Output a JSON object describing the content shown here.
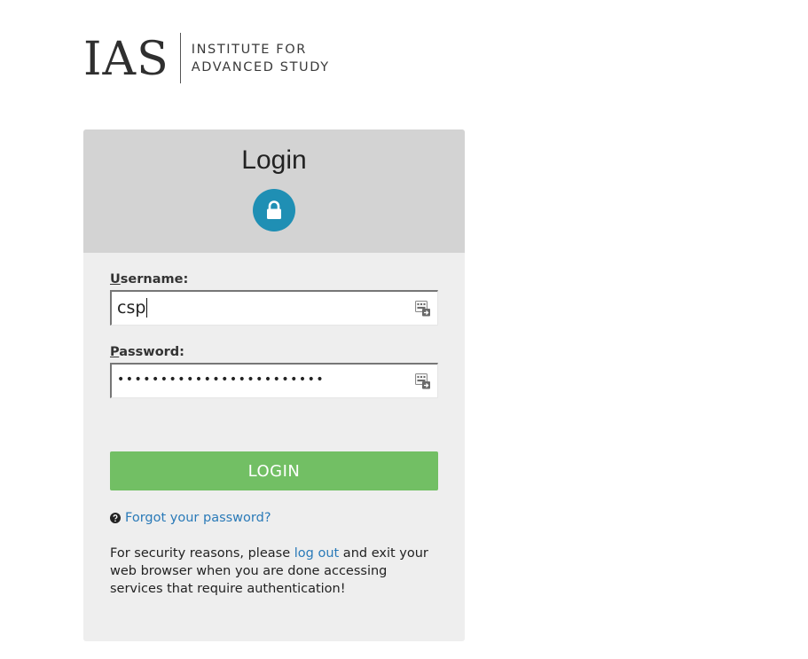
{
  "logo": {
    "mark": "IAS",
    "line1": "INSTITUTE FOR",
    "line2": "ADVANCED STUDY"
  },
  "login": {
    "title": "Login",
    "username_accesskey": "U",
    "username_label_rest": "sername:",
    "username_value": "csp",
    "password_accesskey": "P",
    "password_label_rest": "assword:",
    "password_mask": "••••••••••••••••••••••••",
    "button_label": "LOGIN",
    "forgot_link": "Forgot your password?",
    "notice_before": "For security reasons, please ",
    "notice_link": "log out",
    "notice_after": " and exit your web browser when you are done accessing services that require authentication!"
  },
  "icons": {
    "lock": "lock-icon",
    "keyboard": "keyboard-icon",
    "help": "question-circle-icon"
  },
  "colors": {
    "header_bg": "#d3d3d3",
    "card_bg": "#eeeeee",
    "lock_badge": "#1f8fb4",
    "login_button": "#72bf64",
    "link": "#2a7ab8"
  }
}
